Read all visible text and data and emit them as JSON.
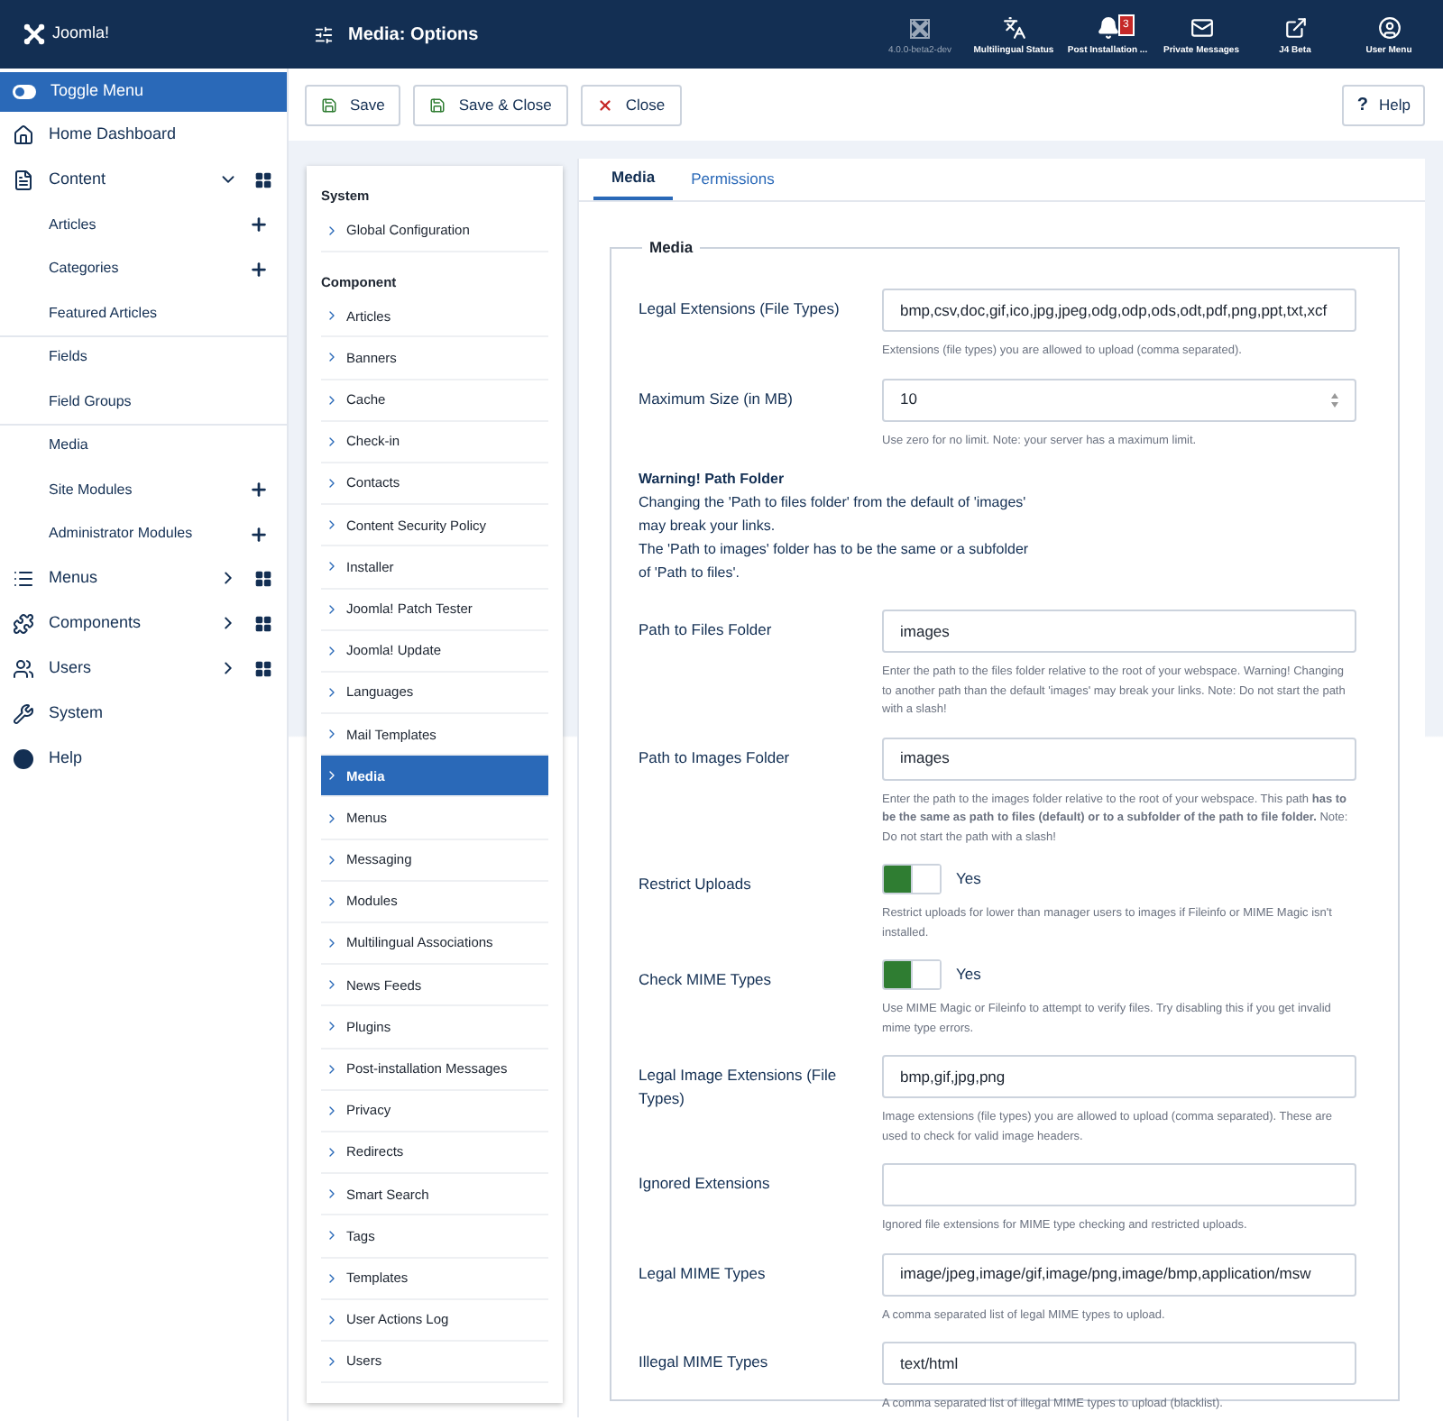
{
  "header": {
    "logo_text": "Joomla!",
    "title": "Media: Options",
    "items": [
      {
        "label": "4.0.0-beta2-dev",
        "muted": true
      },
      {
        "label": "Multilingual Status",
        "muted": false
      },
      {
        "label": "Post Installation ...",
        "muted": false,
        "badge": "3"
      },
      {
        "label": "Private Messages",
        "muted": false
      },
      {
        "label": "J4 Beta",
        "muted": false
      },
      {
        "label": "User Menu",
        "muted": false
      }
    ]
  },
  "sidebar": {
    "toggle": {
      "label": "Toggle Menu",
      "on": true
    },
    "items": [
      {
        "label": "Home Dashboard"
      },
      {
        "label": "Content",
        "expanded": true,
        "dashboard": true,
        "children": [
          {
            "label": "Articles",
            "add": true,
            "divider_before": false
          },
          {
            "label": "Categories",
            "add": true,
            "divider_before": false
          },
          {
            "label": "Featured Articles",
            "add": false,
            "divider_before": false
          },
          {
            "label": "Fields",
            "add": false,
            "divider_before": true
          },
          {
            "label": "Field Groups",
            "add": false,
            "divider_before": false
          },
          {
            "label": "Media",
            "add": false,
            "divider_before": true
          },
          {
            "label": "Site Modules",
            "add": true,
            "divider_before": false
          },
          {
            "label": "Administrator Modules",
            "add": true,
            "divider_before": false
          }
        ]
      },
      {
        "label": "Menus",
        "expanded": false,
        "dashboard": true
      },
      {
        "label": "Components",
        "expanded": false,
        "dashboard": true
      },
      {
        "label": "Users",
        "expanded": false,
        "dashboard": true
      },
      {
        "label": "System"
      },
      {
        "label": "Help"
      }
    ]
  },
  "toolbar": {
    "buttons": [
      {
        "label": "Save",
        "kind": "save"
      },
      {
        "label": "Save & Close",
        "kind": "save"
      },
      {
        "label": "Close",
        "kind": "close"
      }
    ],
    "help": "Help",
    "help_icon": "?"
  },
  "options_list": [
    {
      "heading": "System",
      "items": [
        {
          "label": "Global Configuration",
          "selected": false
        }
      ]
    },
    {
      "heading": "Component",
      "items": [
        {
          "label": "Articles",
          "selected": false
        },
        {
          "label": "Banners",
          "selected": false
        },
        {
          "label": "Cache",
          "selected": false
        },
        {
          "label": "Check-in",
          "selected": false
        },
        {
          "label": "Contacts",
          "selected": false
        },
        {
          "label": "Content Security Policy",
          "selected": false
        },
        {
          "label": "Installer",
          "selected": false
        },
        {
          "label": "Joomla! Patch Tester",
          "selected": false
        },
        {
          "label": "Joomla! Update",
          "selected": false
        },
        {
          "label": "Languages",
          "selected": false
        },
        {
          "label": "Mail Templates",
          "selected": false
        },
        {
          "label": "Media",
          "selected": true
        },
        {
          "label": "Menus",
          "selected": false
        },
        {
          "label": "Messaging",
          "selected": false
        },
        {
          "label": "Modules",
          "selected": false
        },
        {
          "label": "Multilingual Associations",
          "selected": false
        },
        {
          "label": "News Feeds",
          "selected": false
        },
        {
          "label": "Plugins",
          "selected": false
        },
        {
          "label": "Post-installation Messages",
          "selected": false
        },
        {
          "label": "Privacy",
          "selected": false
        },
        {
          "label": "Redirects",
          "selected": false
        },
        {
          "label": "Smart Search",
          "selected": false
        },
        {
          "label": "Tags",
          "selected": false
        },
        {
          "label": "Templates",
          "selected": false
        },
        {
          "label": "User Actions Log",
          "selected": false
        },
        {
          "label": "Users",
          "selected": false
        }
      ]
    }
  ],
  "tabs": [
    {
      "label": "Media",
      "selected": true
    },
    {
      "label": "Permissions",
      "selected": false
    }
  ],
  "fieldset": {
    "legend": "Media",
    "fields": [
      {
        "kind": "text",
        "label": "Legal Extensions (File Types)",
        "value": "bmp,csv,doc,gif,ico,jpg,jpeg,odg,odp,ods,odt,pdf,png,ppt,txt,xcf",
        "help": "Extensions (file types) you are allowed to upload (comma separated)."
      },
      {
        "kind": "number",
        "label": "Maximum Size (in MB)",
        "value": "10",
        "help": "Use zero for no limit. Note: your server has a maximum limit."
      },
      {
        "kind": "warning",
        "label": "Warning! Path Folder",
        "lines": [
          "Changing the 'Path to files folder' from the default of 'images'",
          "may break your links.",
          "The 'Path to images' folder has to be the same or a subfolder",
          "of 'Path to files'."
        ]
      },
      {
        "kind": "text",
        "label": "Path to Files Folder",
        "value": "images",
        "help": "Enter the path to the files folder relative to the root of your webspace. Warning! Changing to another path than the default 'images' may break your links. Note: Do not start the path with a slash!"
      },
      {
        "kind": "text",
        "label": "Path to Images Folder",
        "value": "images",
        "help": "Enter the path to the images folder relative to the root of your webspace. This path **has to be the same as path to files (default) or to a subfolder of the path to file folder.** Note: Do not start the path with a slash!"
      },
      {
        "kind": "toggle",
        "label": "Restrict Uploads",
        "on": true,
        "value": "Yes",
        "help": "Restrict uploads for lower than manager users to images if Fileinfo or MIME Magic isn't installed."
      },
      {
        "kind": "toggle",
        "label": "Check MIME Types",
        "on": true,
        "value": "Yes",
        "help": "Use MIME Magic or Fileinfo to attempt to verify files. Try disabling this if you get invalid mime type errors."
      },
      {
        "kind": "text",
        "label": "Legal Image Extensions (File Types)",
        "value": "bmp,gif,jpg,png",
        "help": "Image extensions (file types) you are allowed to upload (comma separated). These are used to check for valid image headers."
      },
      {
        "kind": "text",
        "label": "Ignored Extensions",
        "help": "Ignored file extensions for MIME type checking and restricted uploads."
      },
      {
        "kind": "text",
        "label": "Legal MIME Types",
        "value": "image/jpeg,image/gif,image/png,image/bmp,application/msw",
        "help": "A comma separated list of legal MIME types to upload."
      },
      {
        "kind": "text",
        "label": "Illegal MIME Types",
        "value": "text/html",
        "help": "A comma separated list of illegal MIME types to upload (blacklist)."
      }
    ]
  }
}
